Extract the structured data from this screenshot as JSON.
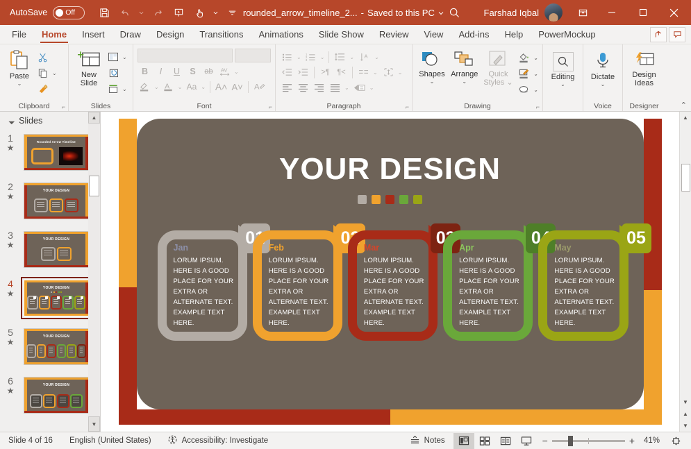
{
  "titlebar": {
    "autosave_label": "AutoSave",
    "autosave_state": "Off",
    "save_icon": "save-icon",
    "undo_icon": "undo-icon",
    "redo_icon": "redo-icon",
    "present_icon": "start-presentation-icon",
    "touch_icon": "touch-mode-icon",
    "more_icon": "customize-qat-icon",
    "file_title": "rounded_arrow_timeline_2...",
    "save_location": "Saved to this PC",
    "search_icon": "search-icon",
    "user_name": "Farshad Iqbal",
    "avatar": "user-avatar",
    "ribbon_display_icon": "ribbon-display-options-icon",
    "minimize_icon": "minimize-icon",
    "maximize_icon": "maximize-icon",
    "close_icon": "close-icon"
  },
  "tabs": [
    {
      "label": "File",
      "active": false
    },
    {
      "label": "Home",
      "active": true
    },
    {
      "label": "Insert",
      "active": false
    },
    {
      "label": "Draw",
      "active": false
    },
    {
      "label": "Design",
      "active": false
    },
    {
      "label": "Transitions",
      "active": false
    },
    {
      "label": "Animations",
      "active": false
    },
    {
      "label": "Slide Show",
      "active": false
    },
    {
      "label": "Review",
      "active": false
    },
    {
      "label": "View",
      "active": false
    },
    {
      "label": "Add-ins",
      "active": false
    },
    {
      "label": "Help",
      "active": false
    },
    {
      "label": "PowerMockup",
      "active": false
    }
  ],
  "tabbar_right": {
    "share_icon": "share-icon",
    "comments_icon": "comments-icon"
  },
  "ribbon": {
    "clipboard": {
      "label": "Clipboard",
      "paste_label": "Paste",
      "paste_icon": "paste-icon",
      "cut_icon": "cut-scissors-icon",
      "copy_icon": "copy-icon",
      "format_painter_icon": "format-painter-icon",
      "launcher_icon": "dialog-launcher-icon"
    },
    "slides": {
      "label": "Slides",
      "new_slide_label": "New Slide",
      "new_slide_icon": "new-slide-icon",
      "layout_icon": "layout-icon",
      "reset_icon": "reset-icon",
      "section_icon": "section-icon"
    },
    "font": {
      "label": "Font",
      "font_name_value": "",
      "font_size_value": "",
      "bold": "B",
      "italic": "I",
      "underline": "U",
      "shadow": "S",
      "strikethrough": "ab",
      "spacing_icon": "character-spacing-icon",
      "highlight_icon": "text-highlight-icon",
      "fontcolor_icon": "font-color-icon",
      "changecase_label": "Aa",
      "grow_label": "A",
      "shrink_label": "A",
      "clear_format_icon": "clear-formatting-icon",
      "launcher_icon": "dialog-launcher-icon"
    },
    "paragraph": {
      "label": "Paragraph",
      "bullets_icon": "bullets-icon",
      "numbering_icon": "numbering-icon",
      "linespacing_icon": "line-spacing-icon",
      "textdirection_icon": "text-direction-icon",
      "decrease_indent_icon": "decrease-indent-icon",
      "increase_indent_icon": "increase-indent-icon",
      "rtl_icon": "right-to-left-icon",
      "ltr_icon": "left-to-right-icon",
      "columns_icon": "columns-icon",
      "align_text_icon": "align-text-icon",
      "align_left_icon": "align-left-icon",
      "align_center_icon": "align-center-icon",
      "align_right_icon": "align-right-icon",
      "justify_icon": "justify-icon",
      "smartart_icon": "convert-to-smartart-icon",
      "launcher_icon": "dialog-launcher-icon"
    },
    "drawing": {
      "label": "Drawing",
      "shapes_label": "Shapes",
      "shapes_icon": "shapes-icon",
      "arrange_label": "Arrange",
      "arrange_icon": "arrange-icon",
      "quick_styles_label": "Quick Styles",
      "quick_styles_icon": "quick-styles-icon",
      "shape_fill_icon": "shape-fill-icon",
      "shape_outline_icon": "shape-outline-icon",
      "shape_effects_icon": "shape-effects-icon",
      "launcher_icon": "dialog-launcher-icon"
    },
    "editing": {
      "label": "Editing",
      "editing_label": "Editing",
      "editing_icon": "find-magnifier-icon"
    },
    "voice": {
      "label": "Voice",
      "dictate_label": "Dictate",
      "dictate_icon": "microphone-icon"
    },
    "designer": {
      "label": "Designer",
      "design_ideas_label": "Design Ideas",
      "design_ideas_icon": "design-ideas-icon"
    },
    "collapse_icon": "collapse-ribbon-icon"
  },
  "slide_panel": {
    "header": "Slides",
    "collapse_icon": "panel-collapse-icon",
    "animation_star_icon": "animation-star-icon",
    "scroll_up_icon": "scroll-up-icon",
    "scroll_down_icon": "scroll-down-icon",
    "thumbnails": [
      {
        "number": "1",
        "title": "Rounded Arrow Timeline",
        "selected": false,
        "kind": "cover"
      },
      {
        "number": "2",
        "title": "YOUR DESIGN",
        "selected": false,
        "kind": "chips",
        "chip_colors": [
          "#b3aca5",
          "#f0a22e",
          "#a82b18"
        ]
      },
      {
        "number": "3",
        "title": "YOUR DESIGN",
        "selected": false,
        "kind": "chips",
        "chip_colors": [
          "#b3aca5",
          "#f0a22e"
        ]
      },
      {
        "number": "4",
        "title": "YOUR DESIGN",
        "selected": true,
        "kind": "chips",
        "chip_colors": [
          "#b3aca5",
          "#f0a22e",
          "#a82b18",
          "#6aa83a",
          "#9aa515"
        ]
      },
      {
        "number": "5",
        "title": "YOUR DESIGN",
        "selected": false,
        "kind": "chips",
        "chip_colors": [
          "#b3aca5",
          "#f0a22e",
          "#a82b18",
          "#6aa83a",
          "#9aa515",
          "#7d2312"
        ]
      },
      {
        "number": "6",
        "title": "YOUR DESIGN",
        "selected": false,
        "kind": "chips",
        "chip_colors": [
          "#b3aca5",
          "#f0a22e",
          "#a82b18",
          "#6aa83a"
        ]
      }
    ]
  },
  "slide": {
    "title": "YOUR DESIGN",
    "dot_colors": [
      "#b3aca5",
      "#f0a22e",
      "#a82b18",
      "#6aa83a",
      "#9aa515"
    ],
    "background": "#6e6358",
    "frame_orange": "#f0a22e",
    "frame_red": "#a82b18",
    "body_text": "LORUM IPSUM.  HERE IS A GOOD PLACE FOR YOUR EXTRA OR ALTERNATE TEXT. EXAMPLE TEXT HERE.",
    "segments": [
      {
        "number": "01",
        "month": "Jan",
        "color": "#b3aca5",
        "month_color": "#8c8fa8",
        "text": "LORUM IPSUM.  HERE IS A GOOD PLACE FOR YOUR EXTRA OR ALTERNATE TEXT. EXAMPLE TEXT HERE."
      },
      {
        "number": "02",
        "month": "Feb",
        "color": "#f0a22e",
        "month_color": "#f0a22e",
        "text": "LORUM IPSUM.  HERE IS A GOOD PLACE FOR YOUR EXTRA OR ALTERNATE TEXT. EXAMPLE TEXT HERE."
      },
      {
        "number": "03",
        "month": "Mar",
        "color": "#a82b18",
        "month_color": "#d4442a",
        "text": "LORUM IPSUM.  HERE IS A GOOD PLACE FOR YOUR EXTRA OR ALTERNATE TEXT. EXAMPLE TEXT HERE."
      },
      {
        "number": "04",
        "month": "Apr",
        "color": "#6aa83a",
        "month_color": "#8cc45e",
        "text": "LORUM IPSUM.  HERE IS A GOOD PLACE FOR YOUR EXTRA OR ALTERNATE TEXT. EXAMPLE TEXT HERE."
      },
      {
        "number": "05",
        "month": "May",
        "color": "#9aa515",
        "month_color": "#9a9a6a",
        "text": "LORUM IPSUM.  HERE IS A GOOD PLACE FOR YOUR EXTRA OR ALTERNATE TEXT. EXAMPLE TEXT HERE."
      }
    ]
  },
  "statusbar": {
    "slide_counter": "Slide 4 of 16",
    "language": "English (United States)",
    "accessibility_icon": "accessibility-icon",
    "accessibility": "Accessibility: Investigate",
    "notes_label": "Notes",
    "notes_icon": "notes-icon",
    "view_normal_icon": "normal-view-icon",
    "view_sorter_icon": "slide-sorter-icon",
    "view_reading_icon": "reading-view-icon",
    "view_slideshow_icon": "slide-show-icon",
    "zoom_out_icon": "zoom-out-icon",
    "zoom_in_icon": "zoom-in-icon",
    "zoom_level": "41%",
    "fit_icon": "fit-to-window-icon"
  }
}
